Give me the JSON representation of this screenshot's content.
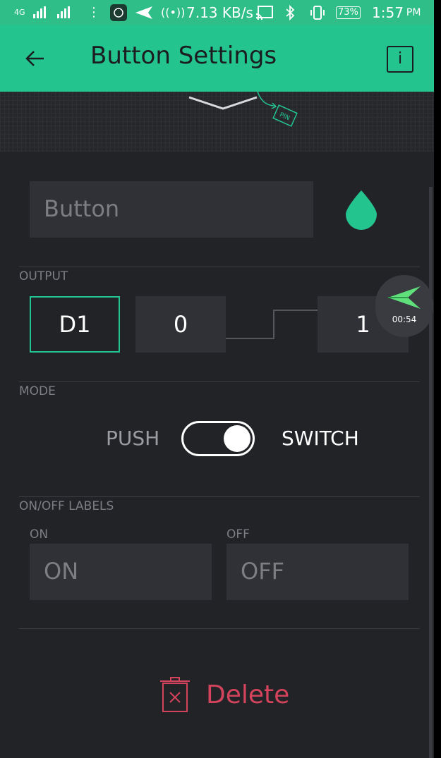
{
  "status_bar": {
    "network": "4G",
    "speed": "7.13 KB/s",
    "battery": "73%",
    "time": "1:57",
    "ampm": "PM"
  },
  "header": {
    "title": "Button Settings"
  },
  "widget_preview": {
    "pin_label": "PIN"
  },
  "name": {
    "value": "Button"
  },
  "output": {
    "label": "OUTPUT",
    "pin": "D1",
    "low": "0",
    "high": "1"
  },
  "recorder": {
    "time": "00:54"
  },
  "mode": {
    "label": "MODE",
    "option_left": "PUSH",
    "option_right": "SWITCH",
    "selected": "SWITCH"
  },
  "labels": {
    "section": "ON/OFF LABELS",
    "on_label": "ON",
    "off_label": "OFF",
    "on_value": "ON",
    "off_value": "OFF"
  },
  "actions": {
    "delete": "Delete"
  },
  "colors": {
    "accent": "#23c48e",
    "danger": "#d3435c",
    "background": "#222327"
  }
}
